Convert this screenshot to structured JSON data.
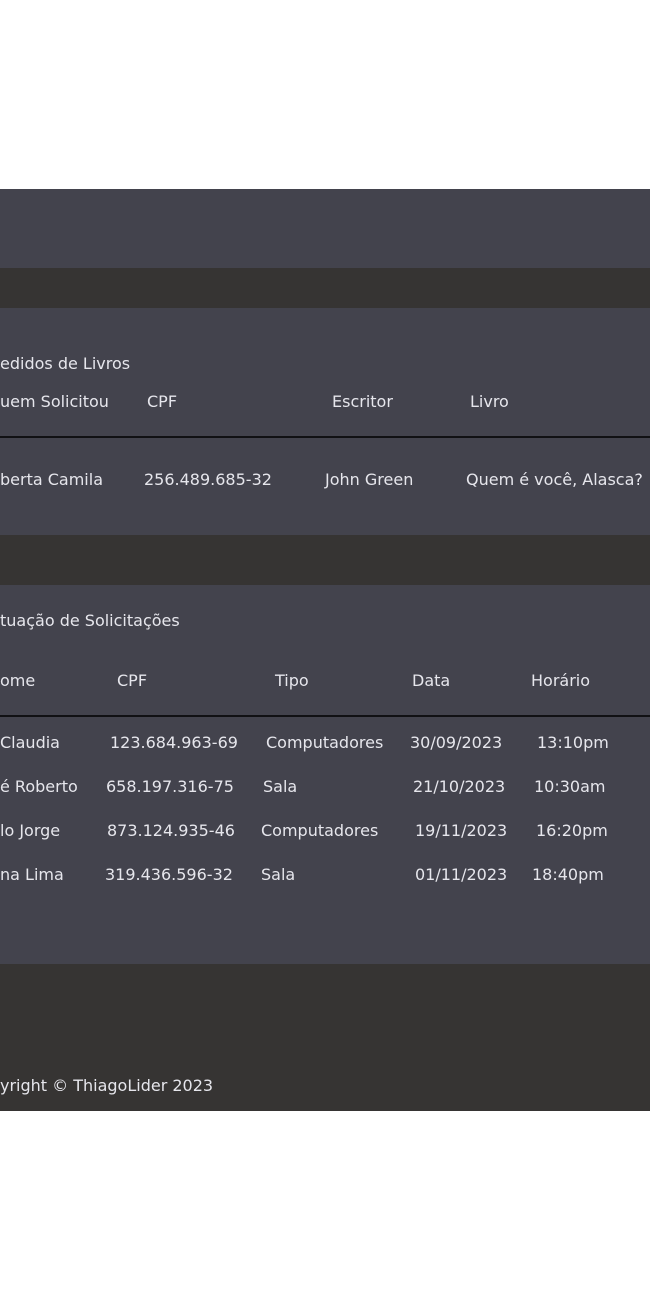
{
  "books": {
    "title": "edidos de Livros",
    "headers": [
      "uem Solicitou",
      "CPF",
      "Escritor",
      "Livro"
    ],
    "rows": [
      [
        "berta Camila",
        "256.489.685-32",
        "John Green",
        "Quem é você, Alasca?"
      ]
    ]
  },
  "requests": {
    "title": "tuação de Solicitações",
    "headers": [
      "ome",
      "CPF",
      "Tipo",
      "Data",
      "Horário"
    ],
    "rows": [
      [
        " Claudia",
        "123.684.963-69",
        "Computadores",
        "30/09/2023",
        "13:10pm"
      ],
      [
        "é Roberto",
        "658.197.316-75",
        "Sala",
        "21/10/2023",
        "10:30am"
      ],
      [
        "lo Jorge",
        "873.124.935-46",
        "Computadores",
        "19/11/2023",
        "16:20pm"
      ],
      [
        "na Lima",
        "319.436.596-32",
        "Sala",
        "01/11/2023",
        "18:40pm"
      ]
    ]
  },
  "footer": {
    "copyright": "yright © ThiagoLider 2023"
  }
}
